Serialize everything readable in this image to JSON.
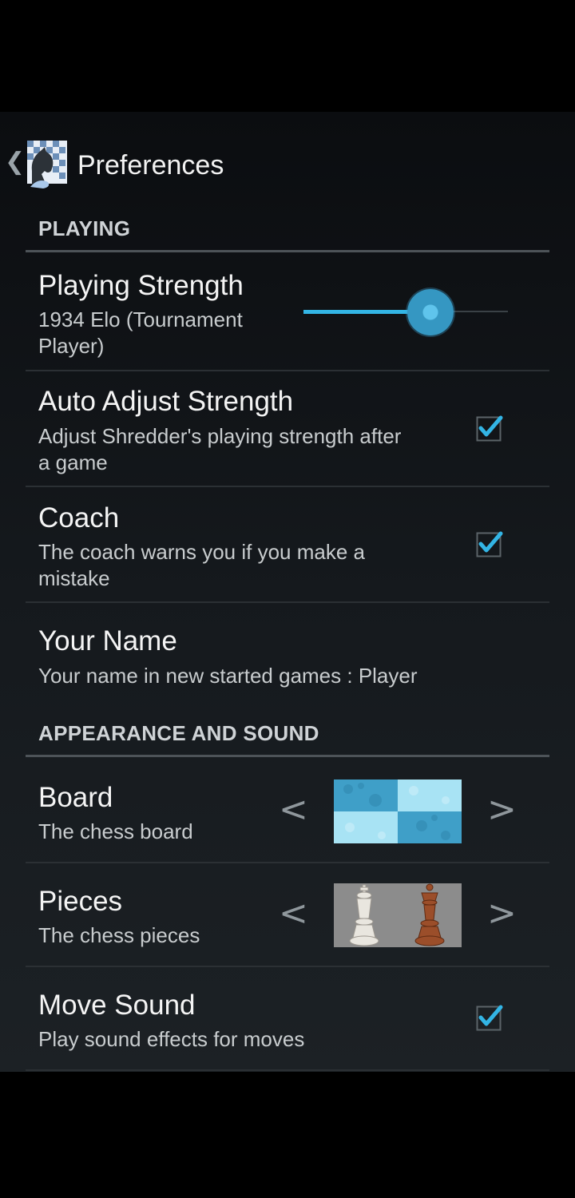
{
  "header": {
    "title": "Preferences"
  },
  "sections": {
    "playing": {
      "header": "PLAYING",
      "playing_strength": {
        "title": "Playing Strength",
        "summary_line1": "1934 Elo (Tournament",
        "summary_line2": "Player)",
        "slider_fraction": 0.62
      },
      "auto_adjust": {
        "title": "Auto Adjust Strength",
        "summary_line1": "Adjust Shredder's playing strength after",
        "summary_line2": "a game",
        "checked": true
      },
      "coach": {
        "title": "Coach",
        "summary_line1": "The coach warns you if you make a",
        "summary_line2": "mistake",
        "checked": true
      },
      "your_name": {
        "title": "Your Name",
        "summary": "Your name in new started games : Player"
      }
    },
    "appearance": {
      "header": "APPEARANCE AND SOUND",
      "board": {
        "title": "Board",
        "summary": "The chess board",
        "prev": "<",
        "next": ">"
      },
      "pieces": {
        "title": "Pieces",
        "summary": "The chess pieces",
        "prev": "<",
        "next": ">"
      },
      "move_sound": {
        "title": "Move Sound",
        "summary": "Play sound effects for moves",
        "checked": true
      }
    }
  },
  "colors": {
    "accent": "#33b5e5",
    "track_inactive": "#3a4146"
  },
  "icons": {
    "up": "chevron-left-icon",
    "app": "shredder-app-icon",
    "check": "checkmark-icon"
  }
}
